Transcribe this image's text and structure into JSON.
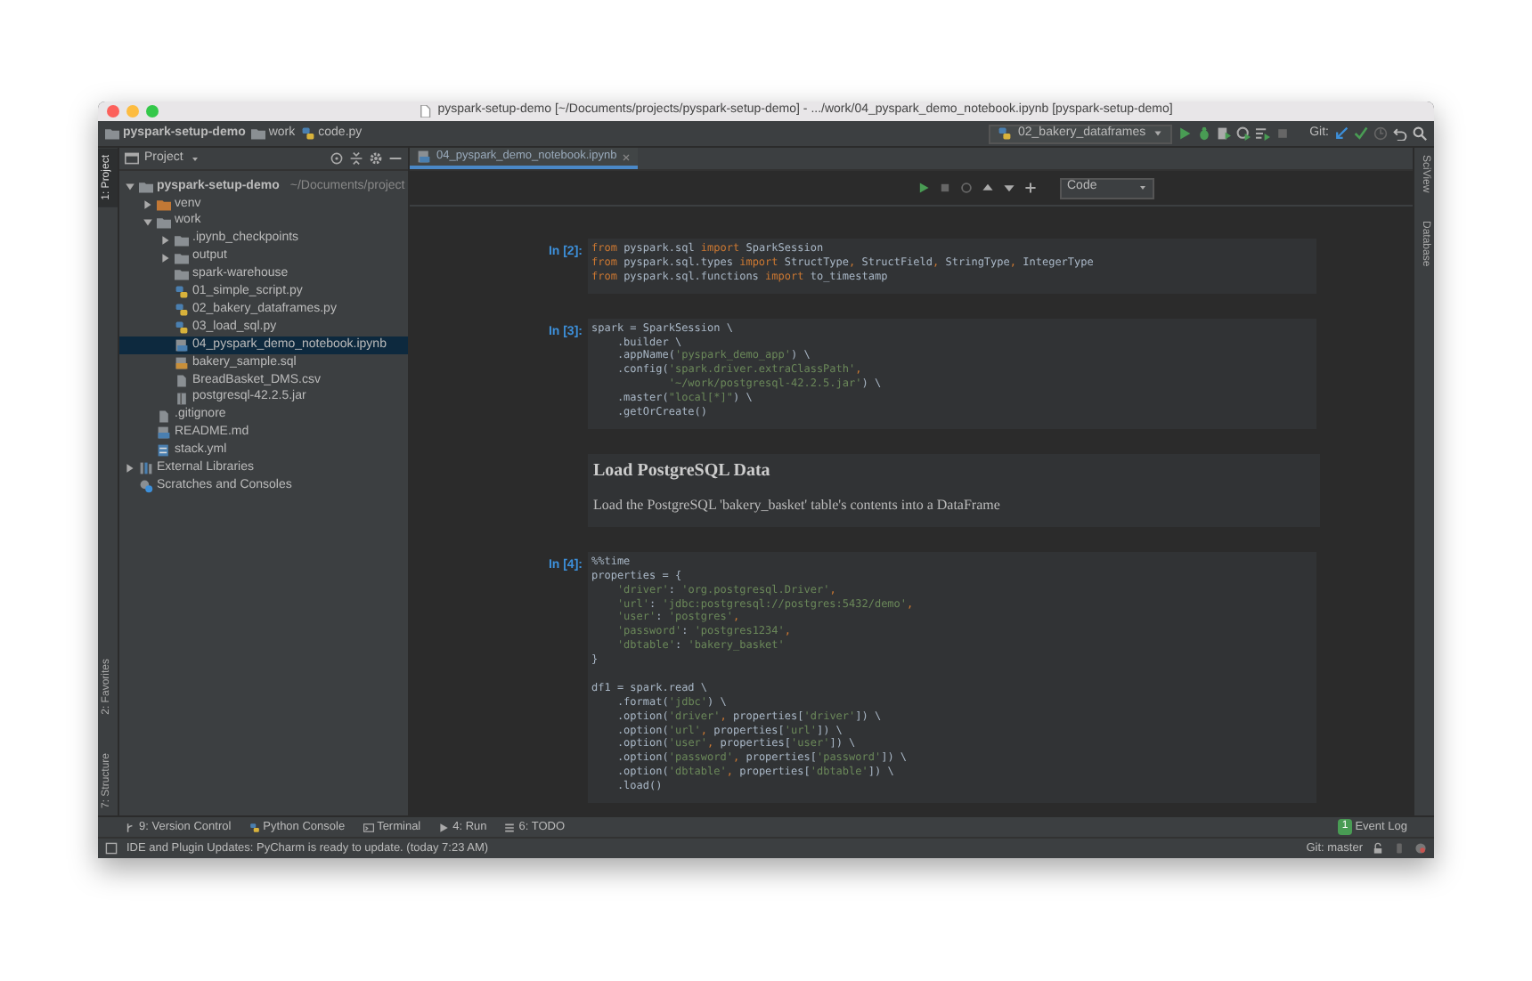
{
  "window": {
    "title": "pyspark-setup-demo [~/Documents/projects/pyspark-setup-demo] - .../work/04_pyspark_demo_notebook.ipynb [pyspark-setup-demo]"
  },
  "breadcrumbs": [
    {
      "label": "pyspark-setup-demo",
      "kind": "folder"
    },
    {
      "label": "work",
      "kind": "folder"
    },
    {
      "label": "code.py",
      "kind": "python"
    }
  ],
  "toolbar": {
    "run_config": "02_bakery_dataframes",
    "git_label": "Git:"
  },
  "left_strip": [
    {
      "label": "1: Project",
      "selected": true
    },
    {
      "label": "2: Favorites",
      "selected": false
    },
    {
      "label": "7: Structure",
      "selected": false
    }
  ],
  "right_strip": [
    {
      "label": "SciView",
      "selected": false
    },
    {
      "label": "Database",
      "selected": false
    }
  ],
  "project_panel": {
    "title": "Project",
    "tree": [
      {
        "label": "pyspark-setup-demo",
        "hint": "~/Documents/project",
        "kind": "folder",
        "expanded": true,
        "selected": false,
        "bold": true,
        "children": [
          {
            "label": "venv",
            "kind": "excluded-folder",
            "expanded": false,
            "selected": false
          },
          {
            "label": "work",
            "kind": "folder",
            "expanded": true,
            "selected": false,
            "children": [
              {
                "label": ".ipynb_checkpoints",
                "kind": "folder",
                "expanded": false,
                "selected": false
              },
              {
                "label": "output",
                "kind": "folder",
                "expanded": false,
                "selected": false
              },
              {
                "label": "spark-warehouse",
                "kind": "folder",
                "selected": false
              },
              {
                "label": "01_simple_script.py",
                "kind": "python",
                "selected": false
              },
              {
                "label": "02_bakery_dataframes.py",
                "kind": "python",
                "selected": false
              },
              {
                "label": "03_load_sql.py",
                "kind": "python",
                "selected": false
              },
              {
                "label": "04_pyspark_demo_notebook.ipynb",
                "kind": "notebook",
                "selected": true
              },
              {
                "label": "bakery_sample.sql",
                "kind": "sql",
                "selected": false
              },
              {
                "label": "BreadBasket_DMS.csv",
                "kind": "text",
                "selected": false
              },
              {
                "label": "postgresql-42.2.5.jar",
                "kind": "jar",
                "selected": false
              }
            ]
          },
          {
            "label": ".gitignore",
            "kind": "text",
            "selected": false
          },
          {
            "label": "README.md",
            "kind": "markdown",
            "selected": false
          },
          {
            "label": "stack.yml",
            "kind": "yml",
            "selected": false
          }
        ]
      },
      {
        "label": "External Libraries",
        "kind": "libraries",
        "expanded": false,
        "selected": false
      },
      {
        "label": "Scratches and Consoles",
        "kind": "scratches",
        "selected": false
      }
    ]
  },
  "editor_tabs": [
    {
      "label": "04_pyspark_demo_notebook.ipynb",
      "selected": true
    }
  ],
  "notebook_toolbar": {
    "cell_type": "Code"
  },
  "cells": [
    {
      "kind": "code",
      "prompt": "In [2]:",
      "blocks": [
        [
          [
            {
              "kind": "keyword",
              "text": "from"
            },
            {
              "kind": "plain",
              "text": " pyspark.sql "
            },
            {
              "kind": "keyword",
              "text": "import"
            },
            {
              "kind": "plain",
              "text": " SparkSession"
            }
          ],
          [
            {
              "kind": "keyword",
              "text": "from"
            },
            {
              "kind": "plain",
              "text": " pyspark.sql.types "
            },
            {
              "kind": "keyword",
              "text": "import"
            },
            {
              "kind": "plain",
              "text": " StructType"
            },
            {
              "kind": "keyword",
              "text": ","
            },
            {
              "kind": "plain",
              "text": " StructField"
            },
            {
              "kind": "keyword",
              "text": ","
            },
            {
              "kind": "plain",
              "text": " StringType"
            },
            {
              "kind": "keyword",
              "text": ","
            },
            {
              "kind": "plain",
              "text": " IntegerType"
            }
          ],
          [
            {
              "kind": "keyword",
              "text": "from"
            },
            {
              "kind": "plain",
              "text": " pyspark.sql.functions "
            },
            {
              "kind": "keyword",
              "text": "import"
            },
            {
              "kind": "plain",
              "text": " to_timestamp"
            }
          ]
        ]
      ]
    },
    {
      "kind": "code",
      "prompt": "In [3]:",
      "blocks": [
        [
          [
            {
              "kind": "plain",
              "text": "spark = SparkSession \\"
            }
          ],
          [
            {
              "kind": "plain",
              "text": "    .builder \\"
            }
          ],
          [
            {
              "kind": "plain",
              "text": "    .appName("
            },
            {
              "kind": "string",
              "text": "'pyspark_demo_app'"
            },
            {
              "kind": "plain",
              "text": ") \\"
            }
          ],
          [
            {
              "kind": "plain",
              "text": "    .config("
            },
            {
              "kind": "string",
              "text": "'spark.driver.extraClassPath'"
            },
            {
              "kind": "keyword",
              "text": ","
            }
          ],
          [
            {
              "kind": "string",
              "text": "            '~/work/postgresql-42.2.5.jar'"
            },
            {
              "kind": "plain",
              "text": ") \\"
            }
          ],
          [
            {
              "kind": "plain",
              "text": "    .master("
            },
            {
              "kind": "string",
              "text": "\"local[*]\""
            },
            {
              "kind": "plain",
              "text": ") \\"
            }
          ],
          [
            {
              "kind": "plain",
              "text": "    .getOrCreate()"
            }
          ]
        ]
      ]
    },
    {
      "kind": "markdown",
      "heading": "Load PostgreSQL Data",
      "text": "Load the PostgreSQL 'bakery_basket' table's contents into a DataFrame"
    },
    {
      "kind": "code",
      "prompt": "In [4]:",
      "blocks": [
        [
          [
            {
              "kind": "plain",
              "text": "%%time"
            }
          ],
          [
            {
              "kind": "plain",
              "text": "properties = {"
            }
          ],
          [
            {
              "kind": "string",
              "text": "    'driver'"
            },
            {
              "kind": "plain",
              "text": ": "
            },
            {
              "kind": "string",
              "text": "'org.postgresql.Driver'"
            },
            {
              "kind": "keyword",
              "text": ","
            }
          ],
          [
            {
              "kind": "string",
              "text": "    'url'"
            },
            {
              "kind": "plain",
              "text": ": "
            },
            {
              "kind": "string",
              "text": "'jdbc:postgresql://postgres:5432/demo'"
            },
            {
              "kind": "keyword",
              "text": ","
            }
          ],
          [
            {
              "kind": "string",
              "text": "    'user'"
            },
            {
              "kind": "plain",
              "text": ": "
            },
            {
              "kind": "string",
              "text": "'postgres'"
            },
            {
              "kind": "keyword",
              "text": ","
            }
          ],
          [
            {
              "kind": "string",
              "text": "    'password'"
            },
            {
              "kind": "plain",
              "text": ": "
            },
            {
              "kind": "string",
              "text": "'postgres1234'"
            },
            {
              "kind": "keyword",
              "text": ","
            }
          ],
          [
            {
              "kind": "string",
              "text": "    'dbtable'"
            },
            {
              "kind": "plain",
              "text": ": "
            },
            {
              "kind": "string",
              "text": "'bakery_basket'"
            }
          ],
          [
            {
              "kind": "plain",
              "text": "}"
            }
          ]
        ],
        [
          [
            {
              "kind": "plain",
              "text": "df1 = spark.read \\"
            }
          ],
          [
            {
              "kind": "plain",
              "text": "    .format("
            },
            {
              "kind": "string",
              "text": "'jdbc'"
            },
            {
              "kind": "plain",
              "text": ") \\"
            }
          ],
          [
            {
              "kind": "plain",
              "text": "    .option("
            },
            {
              "kind": "string",
              "text": "'driver'"
            },
            {
              "kind": "keyword",
              "text": ","
            },
            {
              "kind": "plain",
              "text": " properties["
            },
            {
              "kind": "string",
              "text": "'driver'"
            },
            {
              "kind": "plain",
              "text": "]) \\"
            }
          ],
          [
            {
              "kind": "plain",
              "text": "    .option("
            },
            {
              "kind": "string",
              "text": "'url'"
            },
            {
              "kind": "keyword",
              "text": ","
            },
            {
              "kind": "plain",
              "text": " properties["
            },
            {
              "kind": "string",
              "text": "'url'"
            },
            {
              "kind": "plain",
              "text": "]) \\"
            }
          ],
          [
            {
              "kind": "plain",
              "text": "    .option("
            },
            {
              "kind": "string",
              "text": "'user'"
            },
            {
              "kind": "keyword",
              "text": ","
            },
            {
              "kind": "plain",
              "text": " properties["
            },
            {
              "kind": "string",
              "text": "'user'"
            },
            {
              "kind": "plain",
              "text": "]) \\"
            }
          ],
          [
            {
              "kind": "plain",
              "text": "    .option("
            },
            {
              "kind": "string",
              "text": "'password'"
            },
            {
              "kind": "keyword",
              "text": ","
            },
            {
              "kind": "plain",
              "text": " properties["
            },
            {
              "kind": "string",
              "text": "'password'"
            },
            {
              "kind": "plain",
              "text": "]) \\"
            }
          ],
          [
            {
              "kind": "plain",
              "text": "    .option("
            },
            {
              "kind": "string",
              "text": "'dbtable'"
            },
            {
              "kind": "keyword",
              "text": ","
            },
            {
              "kind": "plain",
              "text": " properties["
            },
            {
              "kind": "string",
              "text": "'dbtable'"
            },
            {
              "kind": "plain",
              "text": "]) \\"
            }
          ],
          [
            {
              "kind": "plain",
              "text": "    .load()"
            }
          ]
        ]
      ]
    }
  ],
  "tool_tabs": [
    {
      "label": "9: Version Control",
      "kind": "vcs"
    },
    {
      "label": "Python Console",
      "kind": "python"
    },
    {
      "label": "Terminal",
      "kind": "terminal"
    },
    {
      "label": "4: Run",
      "kind": "run"
    },
    {
      "label": "6: TODO",
      "kind": "list"
    }
  ],
  "event_log": {
    "label": "Event Log",
    "count": "1"
  },
  "status_bar": {
    "message": "IDE and Plugin Updates: PyCharm is ready to update. (today 7:23 AM)",
    "branch": "Git: master"
  }
}
